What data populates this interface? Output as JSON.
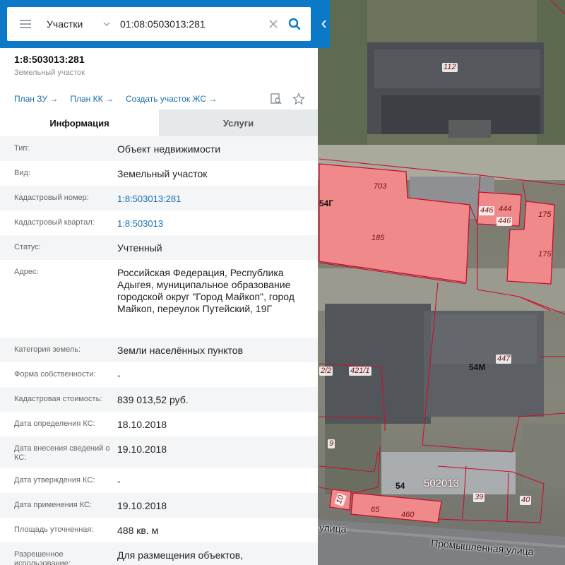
{
  "search": {
    "category": "Участки",
    "value": "01:08:0503013:281"
  },
  "object": {
    "title": "1:8:503013:281",
    "subtitle": "Земельный участок"
  },
  "links": [
    "План ЗУ →",
    "План КК →",
    "Создать участок ЖС →"
  ],
  "tabs": {
    "info": "Информация",
    "services": "Услуги"
  },
  "rows": [
    {
      "label": "Тип:",
      "value": "Объект недвижимости"
    },
    {
      "label": "Вид:",
      "value": "Земельный участок"
    },
    {
      "label": "Кадастровый номер:",
      "value": "1:8:503013:281"
    },
    {
      "label": "Кадастровый квартал:",
      "value": "1:8:503013"
    },
    {
      "label": "Статус:",
      "value": "Учтенный"
    },
    {
      "label": "Адрес:",
      "value": "Российская Федерация, Республика Адыгея, муниципальное образование городской округ \"Город Майкоп\", город Майкоп, переулок Путейский, 19Г"
    },
    {
      "label": "Категория земель:",
      "value": "Земли населённых пунктов"
    },
    {
      "label": "Форма собственности:",
      "value": "-"
    },
    {
      "label": "Кадастровая стоимость:",
      "value": "839 013,52 руб."
    },
    {
      "label": "Дата определения КС:",
      "value": "18.10.2018"
    },
    {
      "label": "Дата внесения сведений о КС:",
      "value": "19.10.2018"
    },
    {
      "label": "Дата утверждения КС:",
      "value": "-"
    },
    {
      "label": "Дата применения КС:",
      "value": "19.10.2018"
    },
    {
      "label": "Площадь уточненная:",
      "value": "488 кв. м"
    },
    {
      "label": "Разрешенное использование:",
      "value": "Для размещения объектов,"
    }
  ],
  "map": {
    "labels": [
      "112",
      "703",
      "54Г",
      "185",
      "446",
      "444",
      "446",
      "175",
      "175",
      "447",
      "54М",
      "421/1",
      "2/2",
      "9",
      "54",
      "502013",
      "39",
      "40",
      "10",
      "65",
      "460"
    ],
    "streets": [
      "Промышленная улица",
      "улица"
    ]
  },
  "colors": {
    "accent": "#0b79c7",
    "parcel_fill": "#f08a8a",
    "parcel_stroke": "#c8102e"
  }
}
